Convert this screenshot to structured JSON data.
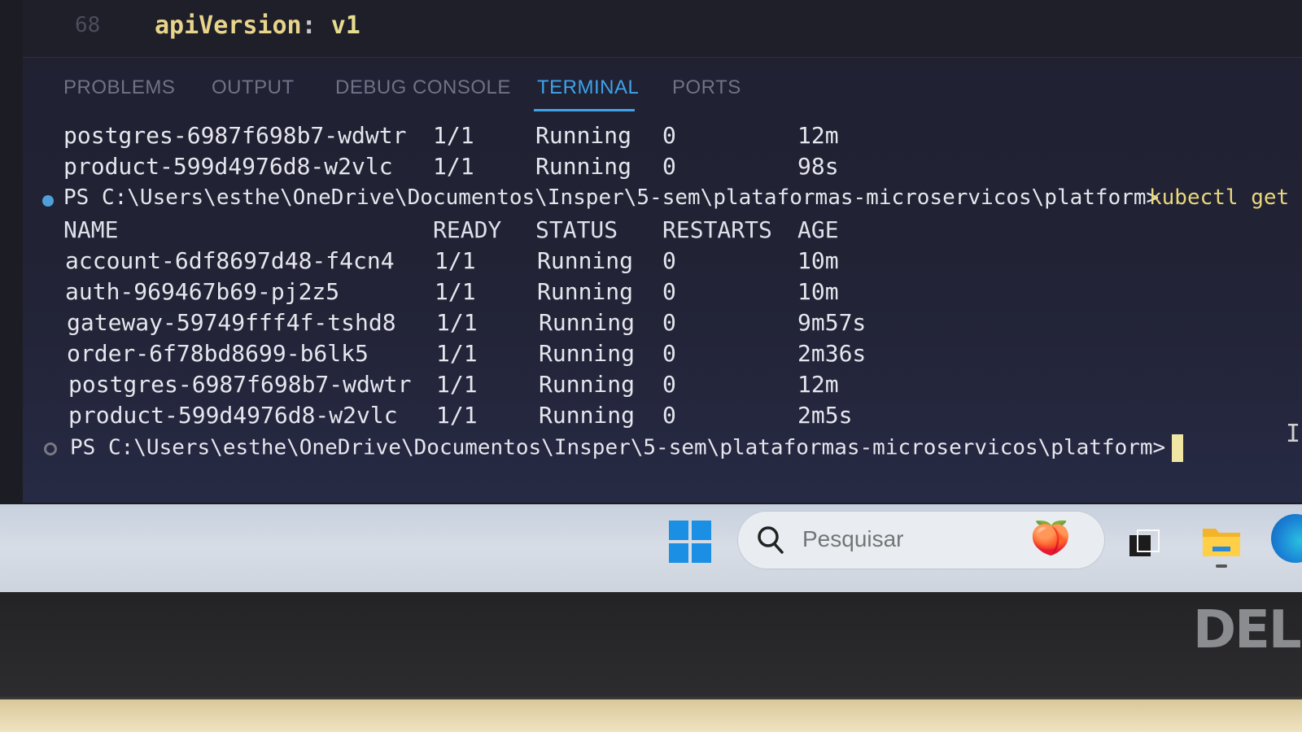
{
  "editor": {
    "line_number": "68",
    "code_key": "apiVersion",
    "code_colon": ":",
    "code_value": "v1"
  },
  "panel": {
    "tabs": [
      {
        "label": "PROBLEMS",
        "active": false
      },
      {
        "label": "OUTPUT",
        "active": false
      },
      {
        "label": "DEBUG CONSOLE",
        "active": false
      },
      {
        "label": "TERMINAL",
        "active": true
      },
      {
        "label": "PORTS",
        "active": false
      }
    ]
  },
  "terminal": {
    "previous_rows": [
      {
        "name": "postgres-6987f698b7-wdwtr",
        "ready": "1/1",
        "status": "Running",
        "restarts": "0",
        "age": "12m"
      },
      {
        "name": "product-599d4976d8-w2vlc",
        "ready": "1/1",
        "status": "Running",
        "restarts": "0",
        "age": "98s"
      }
    ],
    "prompt_path": "PS C:\\Users\\esthe\\OneDrive\\Documentos\\Insper\\5-sem\\plataformas-microservicos\\platform>",
    "command": "kubectl get",
    "headers": {
      "name": "NAME",
      "ready": "READY",
      "status": "STATUS",
      "restarts": "RESTARTS",
      "age": "AGE"
    },
    "rows": [
      {
        "name": "account-6df8697d48-f4cn4",
        "ready": "1/1",
        "status": "Running",
        "restarts": "0",
        "age": "10m"
      },
      {
        "name": "auth-969467b69-pj2z5",
        "ready": "1/1",
        "status": "Running",
        "restarts": "0",
        "age": "10m"
      },
      {
        "name": "gateway-59749fff4f-tshd8",
        "ready": "1/1",
        "status": "Running",
        "restarts": "0",
        "age": "9m57s"
      },
      {
        "name": "order-6f78bd8699-b6lk5",
        "ready": "1/1",
        "status": "Running",
        "restarts": "0",
        "age": "2m36s"
      },
      {
        "name": "postgres-6987f698b7-wdwtr",
        "ready": "1/1",
        "status": "Running",
        "restarts": "0",
        "age": "12m"
      },
      {
        "name": "product-599d4976d8-w2vlc",
        "ready": "1/1",
        "status": "Running",
        "restarts": "0",
        "age": "2m5s"
      }
    ],
    "current_prompt": "PS C:\\Users\\esthe\\OneDrive\\Documentos\\Insper\\5-sem\\plataformas-microservicos\\platform>"
  },
  "taskbar": {
    "search_placeholder": "Pesquisar",
    "icons": [
      "windows-start-icon",
      "search-icon",
      "fruit-widget-icon",
      "task-view-icon",
      "file-explorer-icon",
      "edge-browser-icon"
    ]
  },
  "monitor": {
    "brand": "DELL"
  },
  "colors": {
    "accent": "#3fa3ea",
    "terminal_text": "#e6e6ee",
    "command_text": "#e9d77d"
  }
}
